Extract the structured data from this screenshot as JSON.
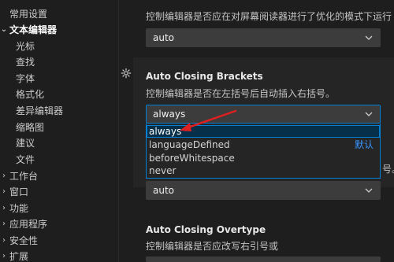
{
  "sidebar": {
    "items": [
      {
        "label": "常用设置",
        "bold": false,
        "chevron": ""
      },
      {
        "label": "文本编辑器",
        "bold": true,
        "chevron": "⌄"
      },
      {
        "label": "光标",
        "bold": false,
        "chevron": ""
      },
      {
        "label": "查找",
        "bold": false,
        "chevron": ""
      },
      {
        "label": "字体",
        "bold": false,
        "chevron": ""
      },
      {
        "label": "格式化",
        "bold": false,
        "chevron": ""
      },
      {
        "label": "差异编辑器",
        "bold": false,
        "chevron": ""
      },
      {
        "label": "缩略图",
        "bold": false,
        "chevron": ""
      },
      {
        "label": "建议",
        "bold": false,
        "chevron": ""
      },
      {
        "label": "文件",
        "bold": false,
        "chevron": ""
      },
      {
        "label": "工作台",
        "bold": false,
        "chevron": "›"
      },
      {
        "label": "窗口",
        "bold": false,
        "chevron": "›"
      },
      {
        "label": "功能",
        "bold": false,
        "chevron": "›"
      },
      {
        "label": "应用程序",
        "bold": false,
        "chevron": "›"
      },
      {
        "label": "安全性",
        "bold": false,
        "chevron": "›"
      },
      {
        "label": "扩展",
        "bold": false,
        "chevron": "›"
      }
    ]
  },
  "settings": {
    "accessibility": {
      "description": "控制编辑器是否应在对屏幕阅读器进行了优化的模式下运行",
      "value": "auto"
    },
    "auto_closing_brackets": {
      "title": "Auto Closing Brackets",
      "description": "控制编辑器是否在左括号后自动插入右括号。",
      "value": "always",
      "options": [
        "always",
        "languageDefined",
        "beforeWhitespace",
        "never"
      ],
      "default_label": "默认",
      "icon": "gear-icon"
    },
    "next": {
      "trailing": "号。",
      "value": "auto"
    },
    "auto_closing_overtype": {
      "title": "Auto Closing Overtype",
      "description": "控制编辑器是否应改写右引号或"
    }
  },
  "colors": {
    "accent": "#007fd4",
    "default_tag": "#3794ff",
    "annotation_arrow": "#e02020"
  }
}
